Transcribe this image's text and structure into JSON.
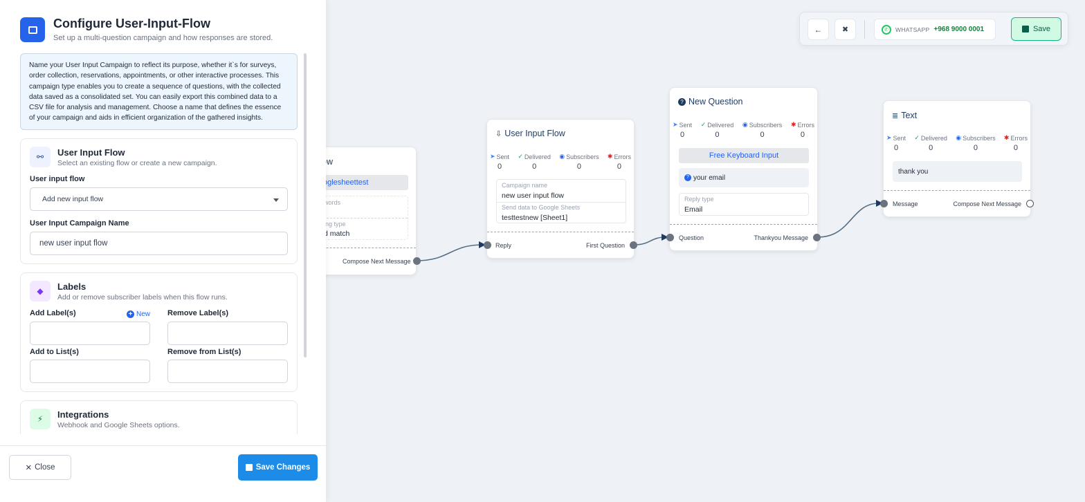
{
  "panel": {
    "title": "Configure User-Input-Flow",
    "subtitle": "Set up a multi-question campaign and how responses are stored.",
    "info_text": "Name your User Input Campaign to reflect its purpose, whether it`s for surveys, order collection, reservations, appointments, or other interactive processes. This campaign type enables you to create a sequence of questions, with the collected data saved as a consolidated set. You can easily export this combined data to a CSV file for analysis and management. Choose a name that defines the essence of your campaign and aids in efficient organization of the gathered insights.",
    "flow_card": {
      "title": "User Input Flow",
      "subtitle": "Select an existing flow or create a new campaign.",
      "flow_label": "User input flow",
      "flow_value": "Add new input flow",
      "name_label": "User Input Campaign Name",
      "name_value": "new user input flow"
    },
    "labels_card": {
      "title": "Labels",
      "subtitle": "Add or remove subscriber labels when this flow runs.",
      "add_label": "Add Label(s)",
      "new_link": "New",
      "remove_label": "Remove Label(s)",
      "add_list": "Add to List(s)",
      "remove_list": "Remove from List(s)"
    },
    "integrations_card": {
      "title": "Integrations",
      "subtitle": "Webhook and Google Sheets options."
    },
    "close_label": "Close",
    "save_label": "Save Changes"
  },
  "toolbar": {
    "channel": "WHATSAPP",
    "phone": "+968 9000 0001",
    "save_label": "Save"
  },
  "stat_labels": {
    "sent": "Sent",
    "delivered": "Delivered",
    "subscribers": "Subscribers",
    "errors": "Errors"
  },
  "nodes": {
    "partial": {
      "title": "ow",
      "sheet": "oglesheettest",
      "keywords_lbl": "words",
      "match_lbl": "ing type",
      "match_val": "d match",
      "out_port": "Compose Next Message"
    },
    "uif": {
      "title": "User Input Flow",
      "stats": [
        "0",
        "0",
        "0",
        "0"
      ],
      "campaign_lbl": "Campaign name",
      "campaign_val": "new user input flow",
      "sheets_lbl": "Send data to Google Sheets",
      "sheets_val": "testtestnew [Sheet1]",
      "in_port": "Reply",
      "out_port": "First Question"
    },
    "question": {
      "title": "New Question",
      "stats": [
        "0",
        "0",
        "0",
        "0"
      ],
      "keyboard": "Free Keyboard Input",
      "prompt": "your email",
      "reply_lbl": "Reply type",
      "reply_val": "Email",
      "in_port": "Question",
      "out_port": "Thankyou Message"
    },
    "text": {
      "title": "Text",
      "stats": [
        "0",
        "0",
        "0",
        "0"
      ],
      "message": "thank you",
      "in_port": "Message",
      "out_port": "Compose Next Message"
    }
  }
}
